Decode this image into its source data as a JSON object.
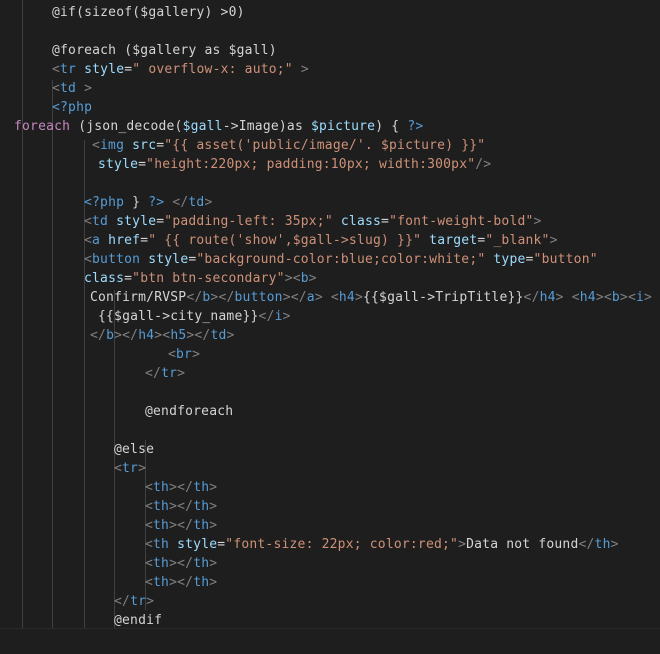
{
  "colors": {
    "background": "#1e1e1e",
    "indent_guide": "#404040",
    "text": "#d4d4d4",
    "tag": "#808080",
    "tag_name": "#569cd6",
    "attribute": "#9cdcfe",
    "string": "#ce9178",
    "keyword": "#c586c0",
    "variable": "#9cdcfe",
    "php_delim": "#569cd6"
  },
  "lines": [
    {
      "indent": 52,
      "segments": [
        [
          "@if(sizeof($gallery) >0)",
          "#d4d4d4"
        ]
      ]
    },
    {
      "indent": 52,
      "segments": []
    },
    {
      "indent": 52,
      "segments": [
        [
          "@foreach ($gallery as $gall)",
          "#d4d4d4"
        ]
      ]
    },
    {
      "indent": 52,
      "segments": [
        [
          "<",
          "#808080"
        ],
        [
          "tr",
          "#569cd6"
        ],
        [
          " style",
          "#9cdcfe"
        ],
        [
          "=",
          "#d4d4d4"
        ],
        [
          "\" overflow-x: auto;\"",
          "#ce9178"
        ],
        [
          " >",
          "#808080"
        ]
      ]
    },
    {
      "indent": 52,
      "segments": [
        [
          "<",
          "#808080"
        ],
        [
          "td",
          "#569cd6"
        ],
        [
          " >",
          "#808080"
        ]
      ]
    },
    {
      "indent": 52,
      "segments": [
        [
          "<?php",
          "#569cd6"
        ]
      ]
    },
    {
      "indent": 14,
      "segments": [
        [
          "foreach",
          "#c586c0"
        ],
        [
          " (json_decode(",
          "#d4d4d4"
        ],
        [
          "$gall",
          "#9cdcfe"
        ],
        [
          "->Image)as ",
          "#d4d4d4"
        ],
        [
          "$picture",
          "#9cdcfe"
        ],
        [
          ") { ",
          "#d4d4d4"
        ],
        [
          "?>",
          "#569cd6"
        ]
      ]
    },
    {
      "indent": 92,
      "segments": [
        [
          "<",
          "#808080"
        ],
        [
          "img",
          "#569cd6"
        ],
        [
          " src",
          "#9cdcfe"
        ],
        [
          "=",
          "#d4d4d4"
        ],
        [
          "\"{{ asset('public/image/'. $picture) }}\"",
          "#ce9178"
        ]
      ]
    },
    {
      "indent": 98,
      "segments": [
        [
          "style",
          "#9cdcfe"
        ],
        [
          "=",
          "#d4d4d4"
        ],
        [
          "\"height:220px; padding:10px; width:300px\"",
          "#ce9178"
        ],
        [
          "/>",
          "#808080"
        ]
      ]
    },
    {
      "indent": 84,
      "segments": []
    },
    {
      "indent": 84,
      "segments": [
        [
          "<?php",
          "#569cd6"
        ],
        [
          " } ",
          "#d4d4d4"
        ],
        [
          "?>",
          "#569cd6"
        ],
        [
          " </",
          "#808080"
        ],
        [
          "td",
          "#569cd6"
        ],
        [
          ">",
          "#808080"
        ]
      ]
    },
    {
      "indent": 84,
      "segments": [
        [
          "<",
          "#808080"
        ],
        [
          "td",
          "#569cd6"
        ],
        [
          " style",
          "#9cdcfe"
        ],
        [
          "=",
          "#d4d4d4"
        ],
        [
          "\"padding-left: 35px;\"",
          "#ce9178"
        ],
        [
          " class",
          "#9cdcfe"
        ],
        [
          "=",
          "#d4d4d4"
        ],
        [
          "\"font-weight-bold\"",
          "#ce9178"
        ],
        [
          ">",
          "#808080"
        ]
      ]
    },
    {
      "indent": 84,
      "segments": [
        [
          "<",
          "#808080"
        ],
        [
          "a",
          "#569cd6"
        ],
        [
          " href",
          "#9cdcfe"
        ],
        [
          "=",
          "#d4d4d4"
        ],
        [
          "\" {{ route('show',$gall->slug) }}\"",
          "#ce9178"
        ],
        [
          " target",
          "#9cdcfe"
        ],
        [
          "=",
          "#d4d4d4"
        ],
        [
          "\"_blank\"",
          "#ce9178"
        ],
        [
          ">",
          "#808080"
        ]
      ]
    },
    {
      "indent": 84,
      "segments": [
        [
          "<",
          "#808080"
        ],
        [
          "button",
          "#569cd6"
        ],
        [
          " style",
          "#9cdcfe"
        ],
        [
          "=",
          "#d4d4d4"
        ],
        [
          "\"background-color:blue;color:white;\"",
          "#ce9178"
        ],
        [
          " type",
          "#9cdcfe"
        ],
        [
          "=",
          "#d4d4d4"
        ],
        [
          "\"button\"",
          "#ce9178"
        ]
      ]
    },
    {
      "indent": 84,
      "segments": [
        [
          "class",
          "#9cdcfe"
        ],
        [
          "=",
          "#d4d4d4"
        ],
        [
          "\"btn btn-secondary\"",
          "#ce9178"
        ],
        [
          "><",
          "#808080"
        ],
        [
          "b",
          "#569cd6"
        ],
        [
          ">",
          "#808080"
        ]
      ]
    },
    {
      "indent": 90,
      "segments": [
        [
          "Confirm/RVSP",
          "#d4d4d4"
        ],
        [
          "</",
          "#808080"
        ],
        [
          "b",
          "#569cd6"
        ],
        [
          "></",
          "#808080"
        ],
        [
          "button",
          "#569cd6"
        ],
        [
          "></",
          "#808080"
        ],
        [
          "a",
          "#569cd6"
        ],
        [
          ">",
          "#808080"
        ],
        [
          " <",
          "#808080"
        ],
        [
          "h4",
          "#569cd6"
        ],
        [
          ">",
          "#808080"
        ],
        [
          "{{$gall->TripTitle}}",
          "#d4d4d4"
        ],
        [
          "</",
          "#808080"
        ],
        [
          "h4",
          "#569cd6"
        ],
        [
          ">",
          "#808080"
        ],
        [
          " <",
          "#808080"
        ],
        [
          "h4",
          "#569cd6"
        ],
        [
          "><",
          "#808080"
        ],
        [
          "b",
          "#569cd6"
        ],
        [
          "><",
          "#808080"
        ],
        [
          "i",
          "#569cd6"
        ],
        [
          ">",
          "#808080"
        ]
      ]
    },
    {
      "indent": 98,
      "segments": [
        [
          "{{$gall->city_name}}",
          "#d4d4d4"
        ],
        [
          "</",
          "#808080"
        ],
        [
          "i",
          "#569cd6"
        ],
        [
          ">",
          "#808080"
        ]
      ]
    },
    {
      "indent": 90,
      "segments": [
        [
          "</",
          "#808080"
        ],
        [
          "b",
          "#569cd6"
        ],
        [
          "></",
          "#808080"
        ],
        [
          "h4",
          "#569cd6"
        ],
        [
          "><",
          "#808080"
        ],
        [
          "h5",
          "#569cd6"
        ],
        [
          "></",
          "#808080"
        ],
        [
          "td",
          "#569cd6"
        ],
        [
          ">",
          "#808080"
        ]
      ]
    },
    {
      "indent": 168,
      "segments": [
        [
          "<",
          "#808080"
        ],
        [
          "br",
          "#569cd6"
        ],
        [
          ">",
          "#808080"
        ]
      ]
    },
    {
      "indent": 145,
      "segments": [
        [
          "</",
          "#808080"
        ],
        [
          "tr",
          "#569cd6"
        ],
        [
          ">",
          "#808080"
        ]
      ]
    },
    {
      "indent": 145,
      "segments": []
    },
    {
      "indent": 145,
      "segments": [
        [
          "@endforeach",
          "#d4d4d4"
        ]
      ]
    },
    {
      "indent": 114,
      "segments": []
    },
    {
      "indent": 114,
      "segments": [
        [
          "@else",
          "#d4d4d4"
        ]
      ]
    },
    {
      "indent": 114,
      "segments": [
        [
          "<",
          "#808080"
        ],
        [
          "tr",
          "#569cd6"
        ],
        [
          ">",
          "#808080"
        ]
      ]
    },
    {
      "indent": 145,
      "segments": [
        [
          "<",
          "#808080"
        ],
        [
          "th",
          "#569cd6"
        ],
        [
          "></",
          "#808080"
        ],
        [
          "th",
          "#569cd6"
        ],
        [
          ">",
          "#808080"
        ]
      ]
    },
    {
      "indent": 145,
      "segments": [
        [
          "<",
          "#808080"
        ],
        [
          "th",
          "#569cd6"
        ],
        [
          "></",
          "#808080"
        ],
        [
          "th",
          "#569cd6"
        ],
        [
          ">",
          "#808080"
        ]
      ]
    },
    {
      "indent": 145,
      "segments": [
        [
          "<",
          "#808080"
        ],
        [
          "th",
          "#569cd6"
        ],
        [
          "></",
          "#808080"
        ],
        [
          "th",
          "#569cd6"
        ],
        [
          ">",
          "#808080"
        ]
      ]
    },
    {
      "indent": 145,
      "segments": [
        [
          "<",
          "#808080"
        ],
        [
          "th",
          "#569cd6"
        ],
        [
          " style",
          "#9cdcfe"
        ],
        [
          "=",
          "#d4d4d4"
        ],
        [
          "\"font-size: 22px; color:red;\"",
          "#ce9178"
        ],
        [
          ">",
          "#808080"
        ],
        [
          "Data not found",
          "#d4d4d4"
        ],
        [
          "</",
          "#808080"
        ],
        [
          "th",
          "#569cd6"
        ],
        [
          ">",
          "#808080"
        ]
      ]
    },
    {
      "indent": 145,
      "segments": [
        [
          "<",
          "#808080"
        ],
        [
          "th",
          "#569cd6"
        ],
        [
          "></",
          "#808080"
        ],
        [
          "th",
          "#569cd6"
        ],
        [
          ">",
          "#808080"
        ]
      ]
    },
    {
      "indent": 145,
      "segments": [
        [
          "<",
          "#808080"
        ],
        [
          "th",
          "#569cd6"
        ],
        [
          "></",
          "#808080"
        ],
        [
          "th",
          "#569cd6"
        ],
        [
          ">",
          "#808080"
        ]
      ]
    },
    {
      "indent": 114,
      "segments": [
        [
          "</",
          "#808080"
        ],
        [
          "tr",
          "#569cd6"
        ],
        [
          ">",
          "#808080"
        ]
      ]
    },
    {
      "indent": 114,
      "segments": [
        [
          "@endif",
          "#d4d4d4"
        ]
      ]
    }
  ]
}
